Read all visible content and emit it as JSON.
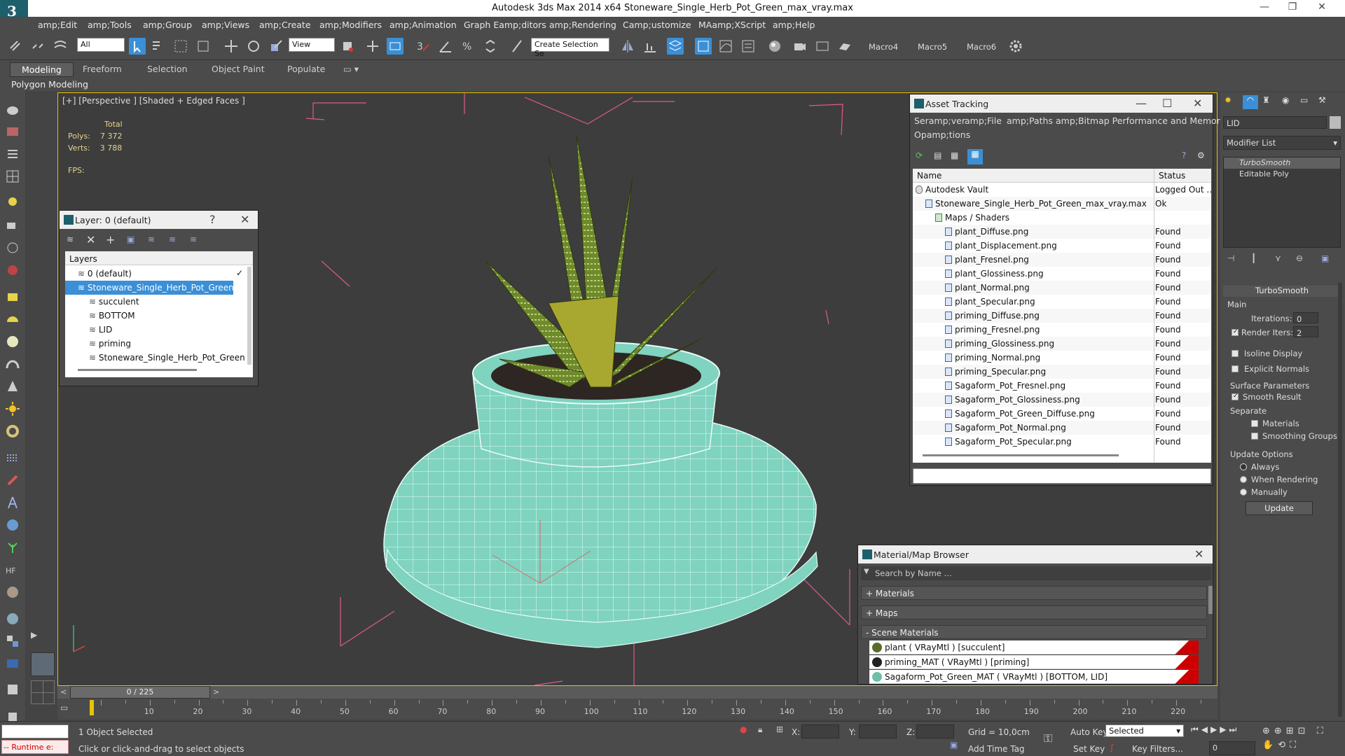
{
  "window": {
    "app_logo_letter": "3",
    "title": "Autodesk 3ds Max  2014 x64      Stoneware_Single_Herb_Pot_Green_max_vray.max"
  },
  "menu": [
    "amp;Edit",
    "amp;Tools",
    "amp;Group",
    "amp;Views",
    "amp;Create",
    "amp;Modifiers",
    "amp;Animation",
    "Graph Eamp;ditors",
    "amp;Rendering",
    "Camp;ustomize",
    "MAamp;XScript",
    "amp;Help"
  ],
  "toolbar": {
    "filter_select": "All",
    "view_select": "View",
    "selection_set": "Create Selection Se",
    "macros": [
      "Macro4",
      "Macro5",
      "Macro6"
    ]
  },
  "ribbon": {
    "tabs": [
      "Modeling",
      "Freeform",
      "Selection",
      "Object Paint",
      "Populate"
    ],
    "sub_label": "Polygon Modeling"
  },
  "viewport": {
    "label": "[+] [Perspective ] [Shaded + Edged Faces ]",
    "stats_total": "Total",
    "polys_label": "Polys:",
    "polys_value": "7 372",
    "verts_label": "Verts:",
    "verts_value": "3 788",
    "fps_label": "FPS:",
    "colors": {
      "pot": "#7fd3bf",
      "plant": "#6e8a2a"
    }
  },
  "layer_dialog": {
    "title": "Layer: 0 (default)",
    "help": "?",
    "tree_header": "Layers",
    "rows": [
      {
        "label": "0 (default)",
        "indent": 0,
        "selected": false
      },
      {
        "label": "Stoneware_Single_Herb_Pot_Green",
        "indent": 0,
        "selected": true
      },
      {
        "label": "succulent",
        "indent": 1,
        "selected": false
      },
      {
        "label": "BOTTOM",
        "indent": 1,
        "selected": false
      },
      {
        "label": "LID",
        "indent": 1,
        "selected": false
      },
      {
        "label": "priming",
        "indent": 1,
        "selected": false
      },
      {
        "label": "Stoneware_Single_Herb_Pot_Green",
        "indent": 1,
        "selected": false
      }
    ]
  },
  "asset_tracking": {
    "title": "Asset Tracking",
    "menu_row1": [
      "Seramp;ver",
      "amp;File",
      "amp;Paths",
      "amp;Bitmap Performance and Memory"
    ],
    "menu_row2": [
      "Opamp;tions"
    ],
    "col_name": "Name",
    "col_status": "Status",
    "rows": [
      {
        "name": "Autodesk Vault",
        "status": "Logged Out ...",
        "level": 0,
        "kind": "vault"
      },
      {
        "name": "Stoneware_Single_Herb_Pot_Green_max_vray.max",
        "status": "Ok",
        "level": 1,
        "kind": "max"
      },
      {
        "name": "Maps / Shaders",
        "status": "",
        "level": 2,
        "kind": "folder"
      },
      {
        "name": "plant_Diffuse.png",
        "status": "Found",
        "level": 3,
        "kind": "file"
      },
      {
        "name": "plant_Displacement.png",
        "status": "Found",
        "level": 3,
        "kind": "file"
      },
      {
        "name": "plant_Fresnel.png",
        "status": "Found",
        "level": 3,
        "kind": "file"
      },
      {
        "name": "plant_Glossiness.png",
        "status": "Found",
        "level": 3,
        "kind": "file"
      },
      {
        "name": "plant_Normal.png",
        "status": "Found",
        "level": 3,
        "kind": "file"
      },
      {
        "name": "plant_Specular.png",
        "status": "Found",
        "level": 3,
        "kind": "file"
      },
      {
        "name": "priming_Diffuse.png",
        "status": "Found",
        "level": 3,
        "kind": "file"
      },
      {
        "name": "priming_Fresnel.png",
        "status": "Found",
        "level": 3,
        "kind": "file"
      },
      {
        "name": "priming_Glossiness.png",
        "status": "Found",
        "level": 3,
        "kind": "file"
      },
      {
        "name": "priming_Normal.png",
        "status": "Found",
        "level": 3,
        "kind": "file"
      },
      {
        "name": "priming_Specular.png",
        "status": "Found",
        "level": 3,
        "kind": "file"
      },
      {
        "name": "Sagaform_Pot_Fresnel.png",
        "status": "Found",
        "level": 3,
        "kind": "file"
      },
      {
        "name": "Sagaform_Pot_Glossiness.png",
        "status": "Found",
        "level": 3,
        "kind": "file"
      },
      {
        "name": "Sagaform_Pot_Green_Diffuse.png",
        "status": "Found",
        "level": 3,
        "kind": "file"
      },
      {
        "name": "Sagaform_Pot_Normal.png",
        "status": "Found",
        "level": 3,
        "kind": "file"
      },
      {
        "name": "Sagaform_Pot_Specular.png",
        "status": "Found",
        "level": 3,
        "kind": "file"
      }
    ]
  },
  "material_browser": {
    "title": "Material/Map Browser",
    "search_placeholder": "Search by Name ...",
    "sections": [
      "+ Materials",
      "+ Maps",
      "- Scene Materials"
    ],
    "scene_materials": [
      {
        "label": "plant  ( VRayMtl ) [succulent]",
        "color": "#5b6b2a"
      },
      {
        "label": "priming_MAT  ( VRayMtl ) [priming]",
        "color": "#222222"
      },
      {
        "label": "Sagaform_Pot_Green_MAT  ( VRayMtl ) [BOTTOM, LID]",
        "color": "#6fbfa8"
      }
    ]
  },
  "command_panel": {
    "object_name": "LID",
    "modifier_list": "Modifier List",
    "stack": [
      "TurboSmooth",
      "Editable Poly"
    ],
    "rollout_title": "TurboSmooth",
    "main_group": "Main",
    "iterations_label": "Iterations:",
    "iterations_value": "0",
    "render_iters_label": "Render Iters:",
    "render_iters_value": "2",
    "render_iters_checked": true,
    "isoline_label": "Isoline Display",
    "explicit_normals_label": "Explicit Normals",
    "surface_params_label": "Surface Parameters",
    "smooth_result_label": "Smooth Result",
    "smooth_result_checked": true,
    "separate_label": "Separate",
    "materials_label": "Materials",
    "smoothing_groups_label": "Smoothing Groups",
    "update_options_label": "Update Options",
    "radio_always": "Always",
    "radio_when_rendering": "When Rendering",
    "radio_manually": "Manually",
    "update_button": "Update"
  },
  "timeline": {
    "frame_counter": "0 / 225",
    "ticks": [
      "10",
      "20",
      "30",
      "40",
      "50",
      "60",
      "70",
      "80",
      "90",
      "100",
      "110",
      "120",
      "130",
      "140",
      "150",
      "160",
      "170",
      "180",
      "190",
      "200",
      "210",
      "220"
    ]
  },
  "status": {
    "runtime": "-- Runtime e:",
    "selected": "1 Object Selected",
    "prompt": "Click or click-and-drag to select objects",
    "x_label": "X:",
    "y_label": "Y:",
    "z_label": "Z:",
    "grid": "Grid = 10,0cm",
    "add_time_tag": "Add Time Tag",
    "auto_key": "Auto Key",
    "set_key": "Set Key",
    "key_mode": "Selected",
    "key_filters": "Key Filters...",
    "frame_value": "0"
  }
}
